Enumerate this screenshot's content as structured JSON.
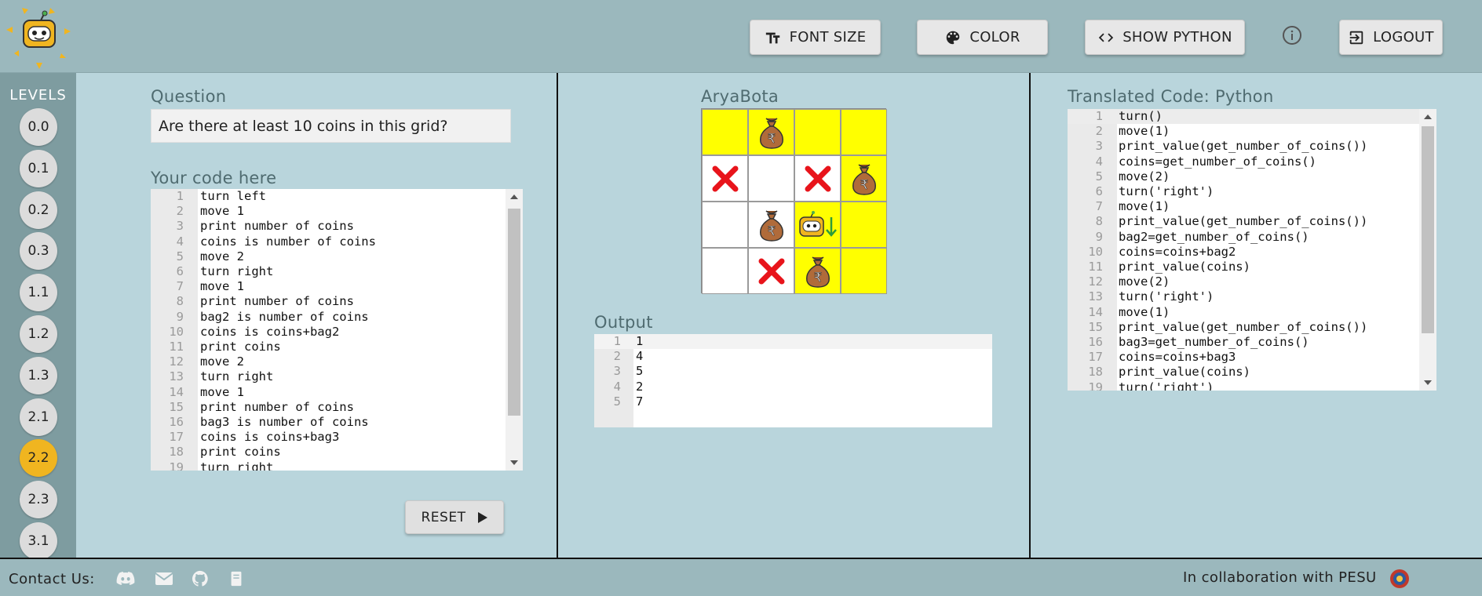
{
  "header": {
    "buttons": {
      "font_size": "FONT SIZE",
      "color": "COLOR",
      "show_python": "SHOW PYTHON",
      "logout": "LOGOUT"
    }
  },
  "sidebar": {
    "title": "LEVELS",
    "levels": [
      "0.0",
      "0.1",
      "0.2",
      "0.3",
      "1.1",
      "1.2",
      "1.3",
      "2.1",
      "2.2",
      "2.3",
      "3.1"
    ],
    "active_level": "2.2",
    "active_color": "#f0b520"
  },
  "question": {
    "label": "Question",
    "text": "Are there at least 10 coins in this grid?"
  },
  "code_editor": {
    "label": "Your code here",
    "lines": [
      "turn left",
      "move 1",
      "print number of coins",
      "coins is number of coins",
      "move 2",
      "turn right",
      "move 1",
      "print number of coins",
      "bag2 is number of coins",
      "coins is coins+bag2",
      "print coins",
      "move 2",
      "turn right",
      "move 1",
      "print number of coins",
      "bag3 is number of coins",
      "coins is coins+bag3",
      "print coins",
      "turn right"
    ]
  },
  "reset_button": {
    "label": "RESET"
  },
  "arena": {
    "label": "AryaBota",
    "grid": [
      [
        "yellow",
        "bag",
        "yellow",
        "yellow"
      ],
      [
        "cross",
        "white",
        "cross",
        "bag"
      ],
      [
        "white",
        "bag",
        "robot",
        "yellow"
      ],
      [
        "white",
        "cross",
        "bag",
        "yellow"
      ]
    ],
    "robot_direction": "down",
    "colors": {
      "yellow": "#ffff00",
      "cross": "#e8141b",
      "bag": "#b06b3a"
    }
  },
  "output": {
    "label": "Output",
    "lines": [
      "1",
      "4",
      "5",
      "2",
      "7"
    ]
  },
  "python": {
    "label": "Translated Code: Python",
    "lines": [
      "turn()",
      "move(1)",
      "print_value(get_number_of_coins())",
      "coins=get_number_of_coins()",
      "move(2)",
      "turn('right')",
      "move(1)",
      "print_value(get_number_of_coins())",
      "bag2=get_number_of_coins()",
      "coins=coins+bag2",
      "print_value(coins)",
      "move(2)",
      "turn('right')",
      "move(1)",
      "print_value(get_number_of_coins())",
      "bag3=get_number_of_coins()",
      "coins=coins+bag3",
      "print_value(coins)",
      "turn('right')"
    ]
  },
  "footer": {
    "contact_label": "Contact Us:",
    "icons": [
      "discord-icon",
      "mail-icon",
      "github-icon",
      "book-icon"
    ],
    "collab_text": "In collaboration with PESU"
  }
}
